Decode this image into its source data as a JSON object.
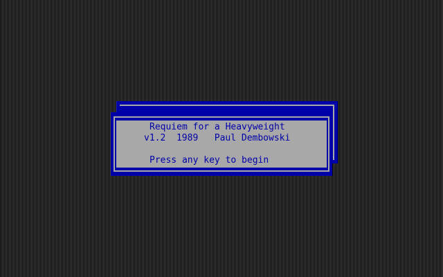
{
  "splash": {
    "title": "Requiem for a Heavyweight",
    "credit": "v1.2  1989   Paul Dembowski",
    "prompt": "Press any key to begin"
  },
  "colors": {
    "screen_background": "#000000",
    "dither": "#4a4a4a",
    "window_blue": "#0000a8",
    "panel_gray": "#a8a8a8",
    "text_blue": "#0000a8"
  }
}
